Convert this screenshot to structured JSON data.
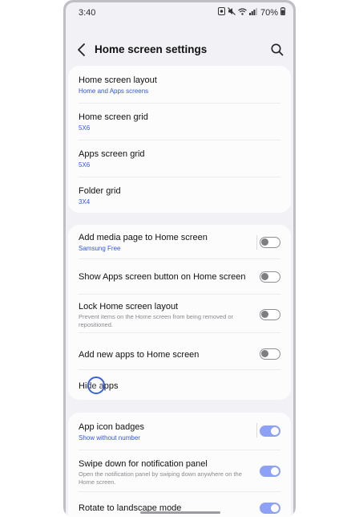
{
  "status": {
    "time": "3:40",
    "battery": "70%"
  },
  "header": {
    "title": "Home screen settings"
  },
  "card1": [
    {
      "title": "Home screen layout",
      "sub": "Home and Apps screens"
    },
    {
      "title": "Home screen grid",
      "sub": "5X6"
    },
    {
      "title": "Apps screen grid",
      "sub": "5X6"
    },
    {
      "title": "Folder grid",
      "sub": "3X4"
    }
  ],
  "card2": [
    {
      "title": "Add media page to Home screen",
      "sub": "Samsung Free",
      "toggle": "off"
    },
    {
      "title": "Show Apps screen button on Home screen",
      "toggle": "off"
    },
    {
      "title": "Lock Home screen layout",
      "desc": "Prevent items on the Home screen from being removed or repositioned.",
      "toggle": "off"
    },
    {
      "title": "Add new apps to Home screen",
      "toggle": "off"
    },
    {
      "title": "Hide apps"
    }
  ],
  "card3": [
    {
      "title": "App icon badges",
      "sub": "Show without number",
      "toggle": "on"
    },
    {
      "title": "Swipe down for notification panel",
      "desc": "Open the notification panel by swiping down anywhere on the Home screen.",
      "toggle": "on"
    },
    {
      "title": "Rotate to landscape mode",
      "toggle": "on"
    }
  ],
  "colors": {
    "accent": "#3455e0",
    "toggle_on": "#8da2f4",
    "background": "#f2f2f6",
    "card": "#fcfcfd"
  }
}
